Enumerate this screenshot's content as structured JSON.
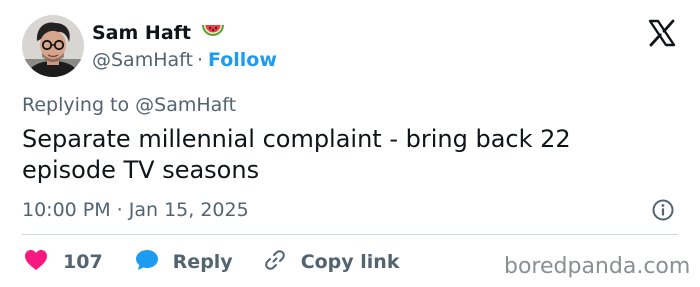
{
  "tweet": {
    "author": {
      "display_name": "Sam Haft",
      "name_emoji": "watermelon-icon",
      "handle": "@SamHaft",
      "separator": "·",
      "follow_label": "Follow"
    },
    "replying_to": "Replying to @SamHaft",
    "text": "Separate millennial complaint - bring back 22 episode TV seasons",
    "timestamp": "10:00 PM · Jan 15, 2025",
    "actions": {
      "like_count": "107",
      "reply_label": "Reply",
      "copy_link_label": "Copy link"
    }
  },
  "watermark": "boredpanda.com",
  "colors": {
    "text": "#0f1419",
    "secondary_text": "#536471",
    "accent": "#1d9bf0",
    "like": "#f91880",
    "divider": "#cfd9de"
  }
}
